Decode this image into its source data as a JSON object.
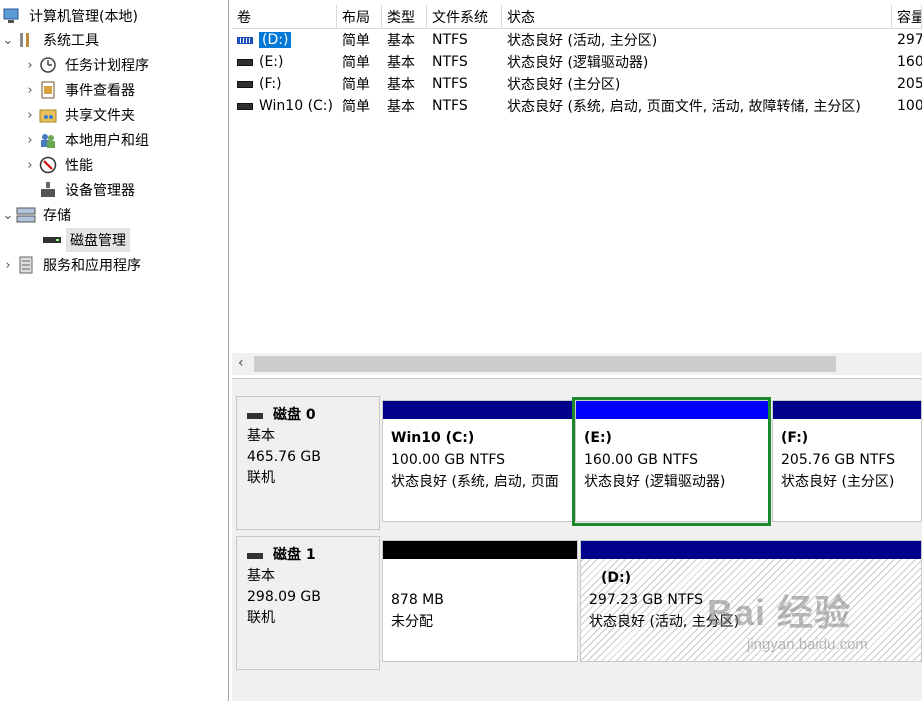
{
  "tree": {
    "items": [
      {
        "label": "计算机管理(本地)",
        "icon": "computer-management-icon"
      },
      {
        "label": "系统工具",
        "icon": "system-tools-icon"
      },
      {
        "label": "任务计划程序",
        "icon": "task-scheduler-icon"
      },
      {
        "label": "事件查看器",
        "icon": "event-viewer-icon"
      },
      {
        "label": "共享文件夹",
        "icon": "shared-folders-icon"
      },
      {
        "label": "本地用户和组",
        "icon": "local-users-icon"
      },
      {
        "label": "性能",
        "icon": "performance-icon"
      },
      {
        "label": "设备管理器",
        "icon": "device-manager-icon"
      },
      {
        "label": "存储",
        "icon": "storage-icon"
      },
      {
        "label": "磁盘管理",
        "icon": "disk-management-icon"
      },
      {
        "label": "服务和应用程序",
        "icon": "services-apps-icon"
      }
    ]
  },
  "volumes": {
    "headers": [
      "卷",
      "布局",
      "类型",
      "文件系统",
      "状态",
      "容量"
    ],
    "rows": [
      {
        "vol": "(D:)",
        "layout": "简单",
        "type": "基本",
        "fs": "NTFS",
        "status": "状态良好 (活动, 主分区)",
        "cap": "297"
      },
      {
        "vol": "(E:)",
        "layout": "简单",
        "type": "基本",
        "fs": "NTFS",
        "status": "状态良好 (逻辑驱动器)",
        "cap": "160"
      },
      {
        "vol": "(F:)",
        "layout": "简单",
        "type": "基本",
        "fs": "NTFS",
        "status": "状态良好 (主分区)",
        "cap": "205"
      },
      {
        "vol": "Win10 (C:)",
        "layout": "简单",
        "type": "基本",
        "fs": "NTFS",
        "status": "状态良好 (系统, 启动, 页面文件, 活动, 故障转储, 主分区)",
        "cap": "100"
      }
    ]
  },
  "disks": [
    {
      "name": "磁盘 0",
      "type": "基本",
      "size": "465.76 GB",
      "state": "联机",
      "partitions": [
        {
          "title": "Win10  (C:)",
          "size": "100.00 GB NTFS",
          "status": "状态良好 (系统, 启动, 页面"
        },
        {
          "title": "(E:)",
          "size": "160.00 GB NTFS",
          "status": "状态良好 (逻辑驱动器)"
        },
        {
          "title": "(F:)",
          "size": "205.76 GB NTFS",
          "status": "状态良好 (主分区)"
        }
      ]
    },
    {
      "name": "磁盘 1",
      "type": "基本",
      "size": "298.09 GB",
      "state": "联机",
      "partitions": [
        {
          "title": "",
          "size": "878 MB",
          "status": "未分配"
        },
        {
          "title": "(D:)",
          "size": "297.23 GB NTFS",
          "status": "状态良好 (活动, 主分区)"
        }
      ]
    }
  ],
  "colors": {
    "primary_bar": "#00008b",
    "logical_bar": "#0000ff",
    "unallocated_bar": "#000000",
    "selection": "#1c8a2c"
  },
  "watermark": {
    "main": "Bai 经验",
    "sub": "jingyan.baidu.com"
  }
}
